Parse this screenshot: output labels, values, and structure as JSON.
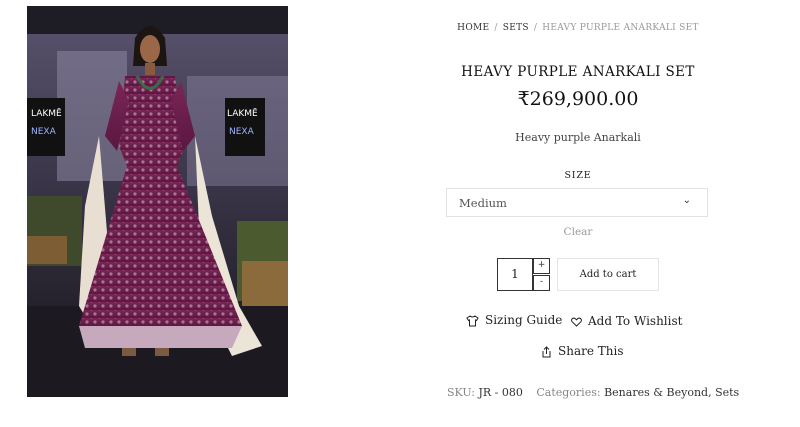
{
  "breadcrumb": {
    "home": "HOME",
    "sets": "SETS",
    "current": "HEAVY PURPLE ANARKALI SET",
    "separator": "/"
  },
  "product": {
    "title": "HEAVY PURPLE ANARKALI SET",
    "price": "₹269,900.00",
    "description": "Heavy purple Anarkali",
    "image_banner_text_1": "LAKMĒ",
    "image_banner_text_2": "NEXA"
  },
  "variation": {
    "label": "SIZE",
    "selected": "Medium",
    "clear_label": "Clear"
  },
  "cart": {
    "quantity": "1",
    "plus": "+",
    "minus": "-",
    "add_label": "Add to cart"
  },
  "actions": {
    "sizing_guide": "Sizing Guide",
    "wishlist": "Add To Wishlist",
    "share": "Share This"
  },
  "meta": {
    "sku_label": "SKU:",
    "sku_value": "JR - 080",
    "categories_label": "Categories:",
    "category_1": "Benares & Beyond",
    "category_2": "Sets",
    "separator": ","
  },
  "colors": {
    "dress_purple": "#6e1f4c",
    "text_dark": "#222222",
    "text_muted": "#999999",
    "border": "#e2e2e2"
  }
}
